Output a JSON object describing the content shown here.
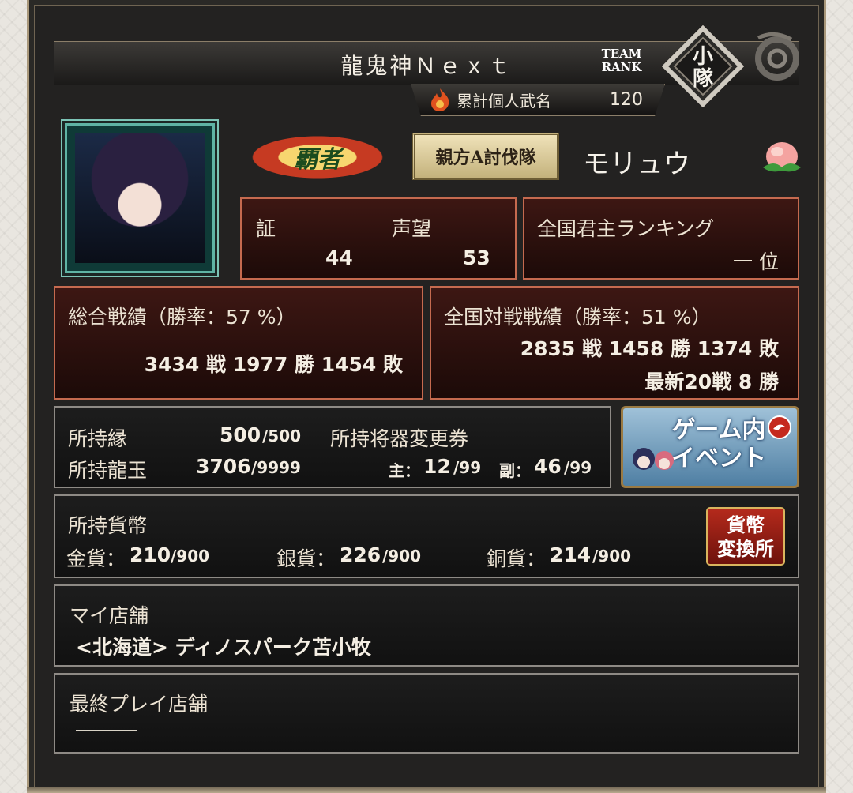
{
  "header": {
    "player_name": "龍鬼神Ｎｅｘｔ",
    "team_rank_label": "TEAM RANK",
    "team_rank_value": "小隊",
    "title_label": "累計個人武名",
    "title_value": "120"
  },
  "profile": {
    "rank_badge": "覇者",
    "squad_badge": "親方A討伐隊",
    "nickname": "モリュウ"
  },
  "stats_top": {
    "shou_label": "証",
    "shou_value": "44",
    "seibou_label": "声望",
    "seibou_value": "53",
    "ranking_label": "全国君主ランキング",
    "ranking_value": "一 位"
  },
  "overall": {
    "label": "総合戦績（勝率：57 %）",
    "record": "3434 戦 1977 勝 1454 敗"
  },
  "national": {
    "label": "全国対戦戦績（勝率：51 %）",
    "record": "2835 戦 1458 勝 1374 敗",
    "recent": "最新20戦 8 勝"
  },
  "holdings": {
    "en_label": "所持縁",
    "en_value": "500",
    "en_max": "/500",
    "ryugyoku_label": "所持龍玉",
    "ryugyoku_value": "3706",
    "ryugyoku_max": "/9999",
    "ticket_label": "所持将器変更券",
    "main_label": "主：",
    "main_value": "12",
    "main_max": "/99",
    "sub_label": "副：",
    "sub_value": "46",
    "sub_max": "/99"
  },
  "event_button": {
    "label_line1": "ゲーム内",
    "label_line2": "イベント"
  },
  "currency": {
    "label": "所持貨幣",
    "gold_label": "金貨：",
    "gold_value": "210",
    "gold_max": "/900",
    "silver_label": "銀貨：",
    "silver_value": "226",
    "silver_max": "/900",
    "copper_label": "銅貨：",
    "copper_value": "214",
    "copper_max": "/900",
    "exchange_line1": "貨幣",
    "exchange_line2": "変換所"
  },
  "my_store": {
    "label": "マイ店舗",
    "value": "<北海道> ディノスパーク苫小牧"
  },
  "last_store": {
    "label": "最終プレイ店舗",
    "value": ""
  }
}
